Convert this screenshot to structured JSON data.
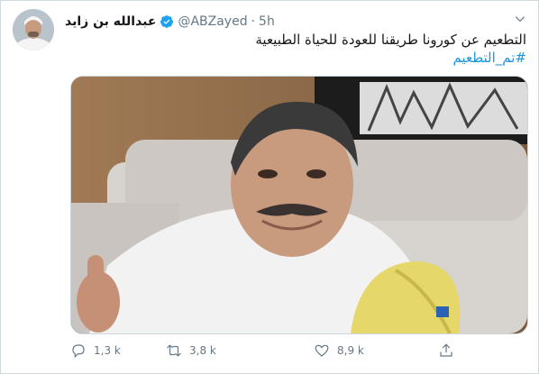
{
  "tweet": {
    "display_name": "عبدالله بن زايد",
    "handle": "@ABZayed",
    "separator": "·",
    "time": "5h",
    "text": "التطعيم عن كورونا طريقنا للعودة للحياة الطبيعية",
    "hashtag": "#تم_التطعيم"
  },
  "actions": {
    "replies": "1,3 k",
    "retweets": "3,8 k",
    "likes": "8,9 k"
  },
  "colors": {
    "accent": "#1da1f2",
    "hashtag": "#1b95e0",
    "muted": "#657786"
  },
  "icons": [
    "verified-badge-icon",
    "chevron-down-icon",
    "reply-icon",
    "retweet-icon",
    "like-icon",
    "share-icon"
  ]
}
